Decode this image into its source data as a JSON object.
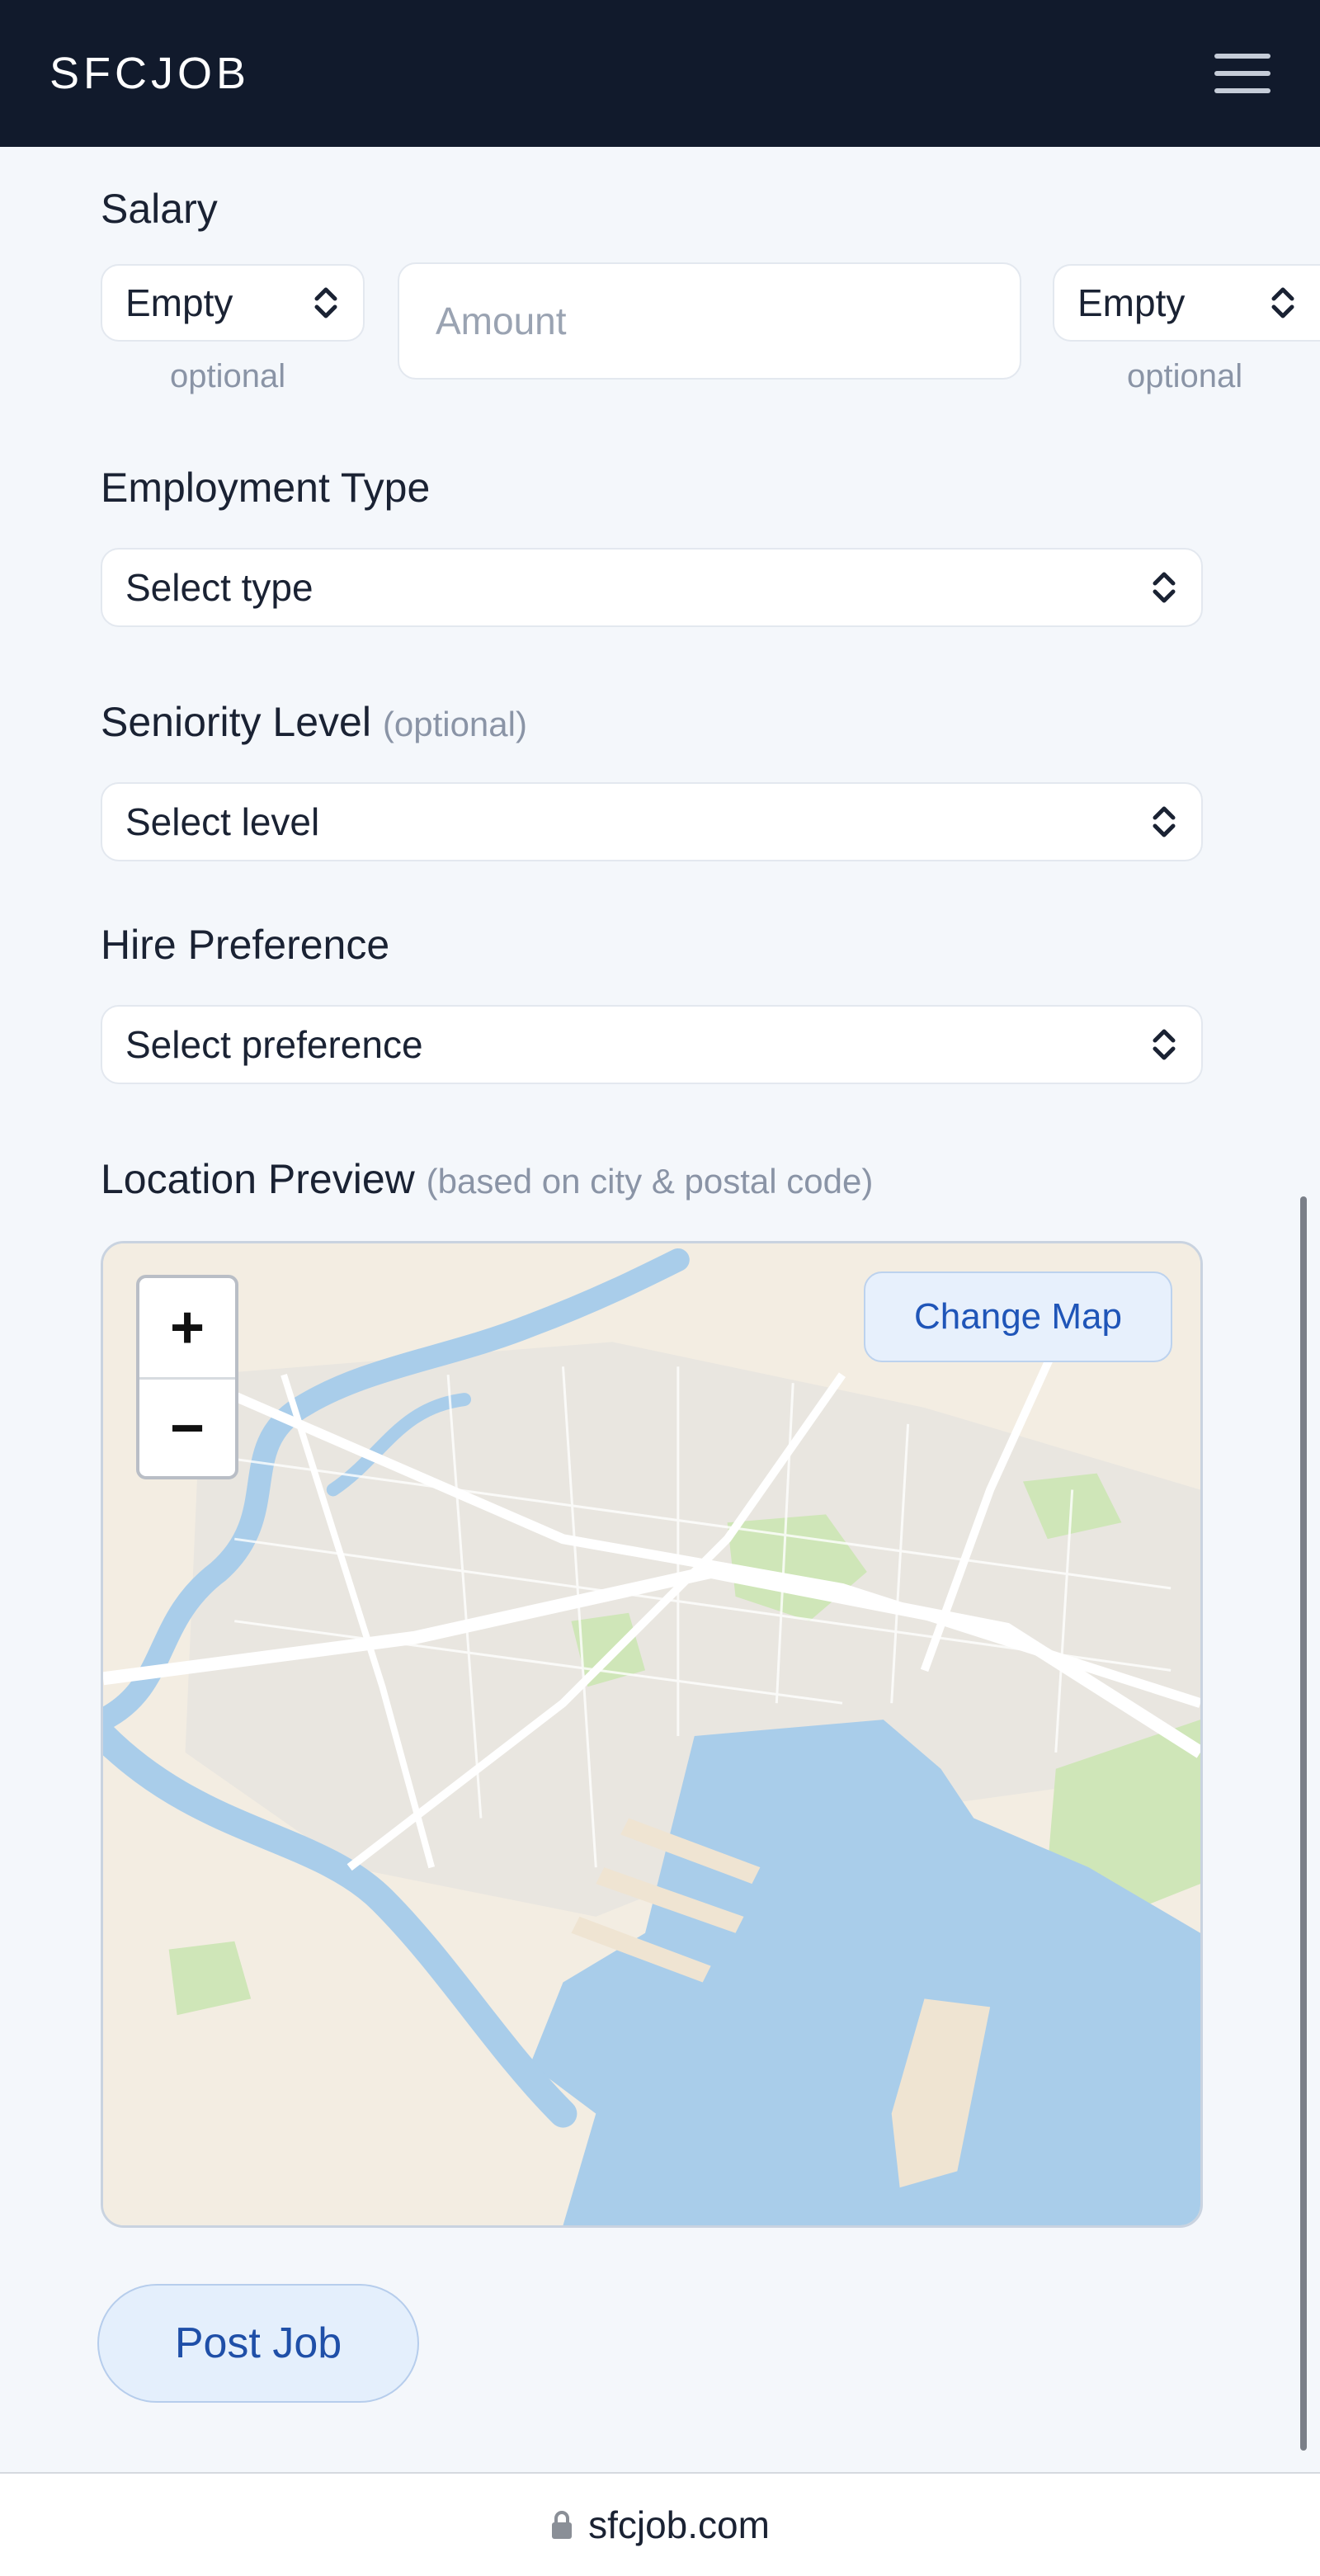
{
  "header": {
    "brand": "SFCJOB",
    "menu_icon": "hamburger-menu-icon"
  },
  "salary": {
    "label": "Salary",
    "currency_select": "Empty",
    "currency_hint": "optional",
    "amount_placeholder": "Amount",
    "amount_value": "",
    "period_select": "Empty",
    "period_hint": "optional"
  },
  "employment_type": {
    "label": "Employment Type",
    "selected": "Select type"
  },
  "seniority": {
    "label": "Seniority Level",
    "label_hint": "(optional)",
    "selected": "Select level"
  },
  "hire_preference": {
    "label": "Hire Preference",
    "selected": "Select preference"
  },
  "location_preview": {
    "label": "Location Preview",
    "label_hint": "(based on city & postal code)",
    "zoom_in": "+",
    "zoom_out": "−",
    "change_map_label": "Change Map"
  },
  "actions": {
    "post_job_label": "Post Job"
  },
  "browser": {
    "url": "sfcjob.com",
    "lock_icon": "lock-icon"
  },
  "colors": {
    "header_bg": "#111a2c",
    "page_bg": "#f4f7fb",
    "accent": "#1f55b8",
    "water": "#a9cdea",
    "land": "#f3ede2",
    "park": "#cfe6b8"
  }
}
